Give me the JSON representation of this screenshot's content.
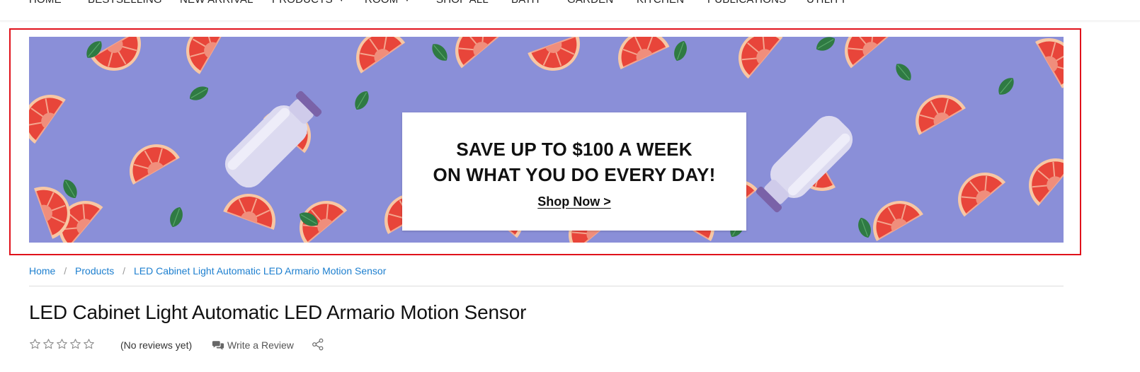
{
  "nav": {
    "items": [
      {
        "label": "HOME",
        "has_caret": false
      },
      {
        "label": "BESTSELLING",
        "has_caret": false
      },
      {
        "label": "NEW ARRIVAL",
        "has_caret": false
      },
      {
        "label": "PRODUCTS",
        "has_caret": true
      },
      {
        "label": "ROOM",
        "has_caret": true
      },
      {
        "label": "SHOP ALL",
        "has_caret": false
      },
      {
        "label": "BATH",
        "has_caret": false
      },
      {
        "label": "GARDEN",
        "has_caret": false
      },
      {
        "label": "KITCHEN",
        "has_caret": false
      },
      {
        "label": "PUBLICATIONS",
        "has_caret": false
      },
      {
        "label": "UTILITY",
        "has_caret": false
      }
    ],
    "caret_icon": "chevron-down-icon"
  },
  "banner": {
    "line1": "SAVE UP TO $100 A WEEK",
    "line2": "ON WHAT YOU DO EVERY DAY!",
    "cta": "Shop Now >",
    "background_color": "#8a8fd8",
    "highlight_border_color": "#e0121b"
  },
  "breadcrumb": {
    "items": [
      "Home",
      "Products",
      "LED Cabinet Light Automatic LED Armario Motion Sensor"
    ],
    "separator": "/",
    "link_color": "#1d7fcf"
  },
  "product": {
    "title": "LED Cabinet Light Automatic LED Armario Motion Sensor",
    "rating": 0,
    "rating_max": 5,
    "reviews_text": "(No reviews yet)",
    "write_review_label": "Write a Review",
    "write_review_icon": "comments-icon",
    "share_icon": "share-icon",
    "star_icon": "star-outline-icon"
  }
}
